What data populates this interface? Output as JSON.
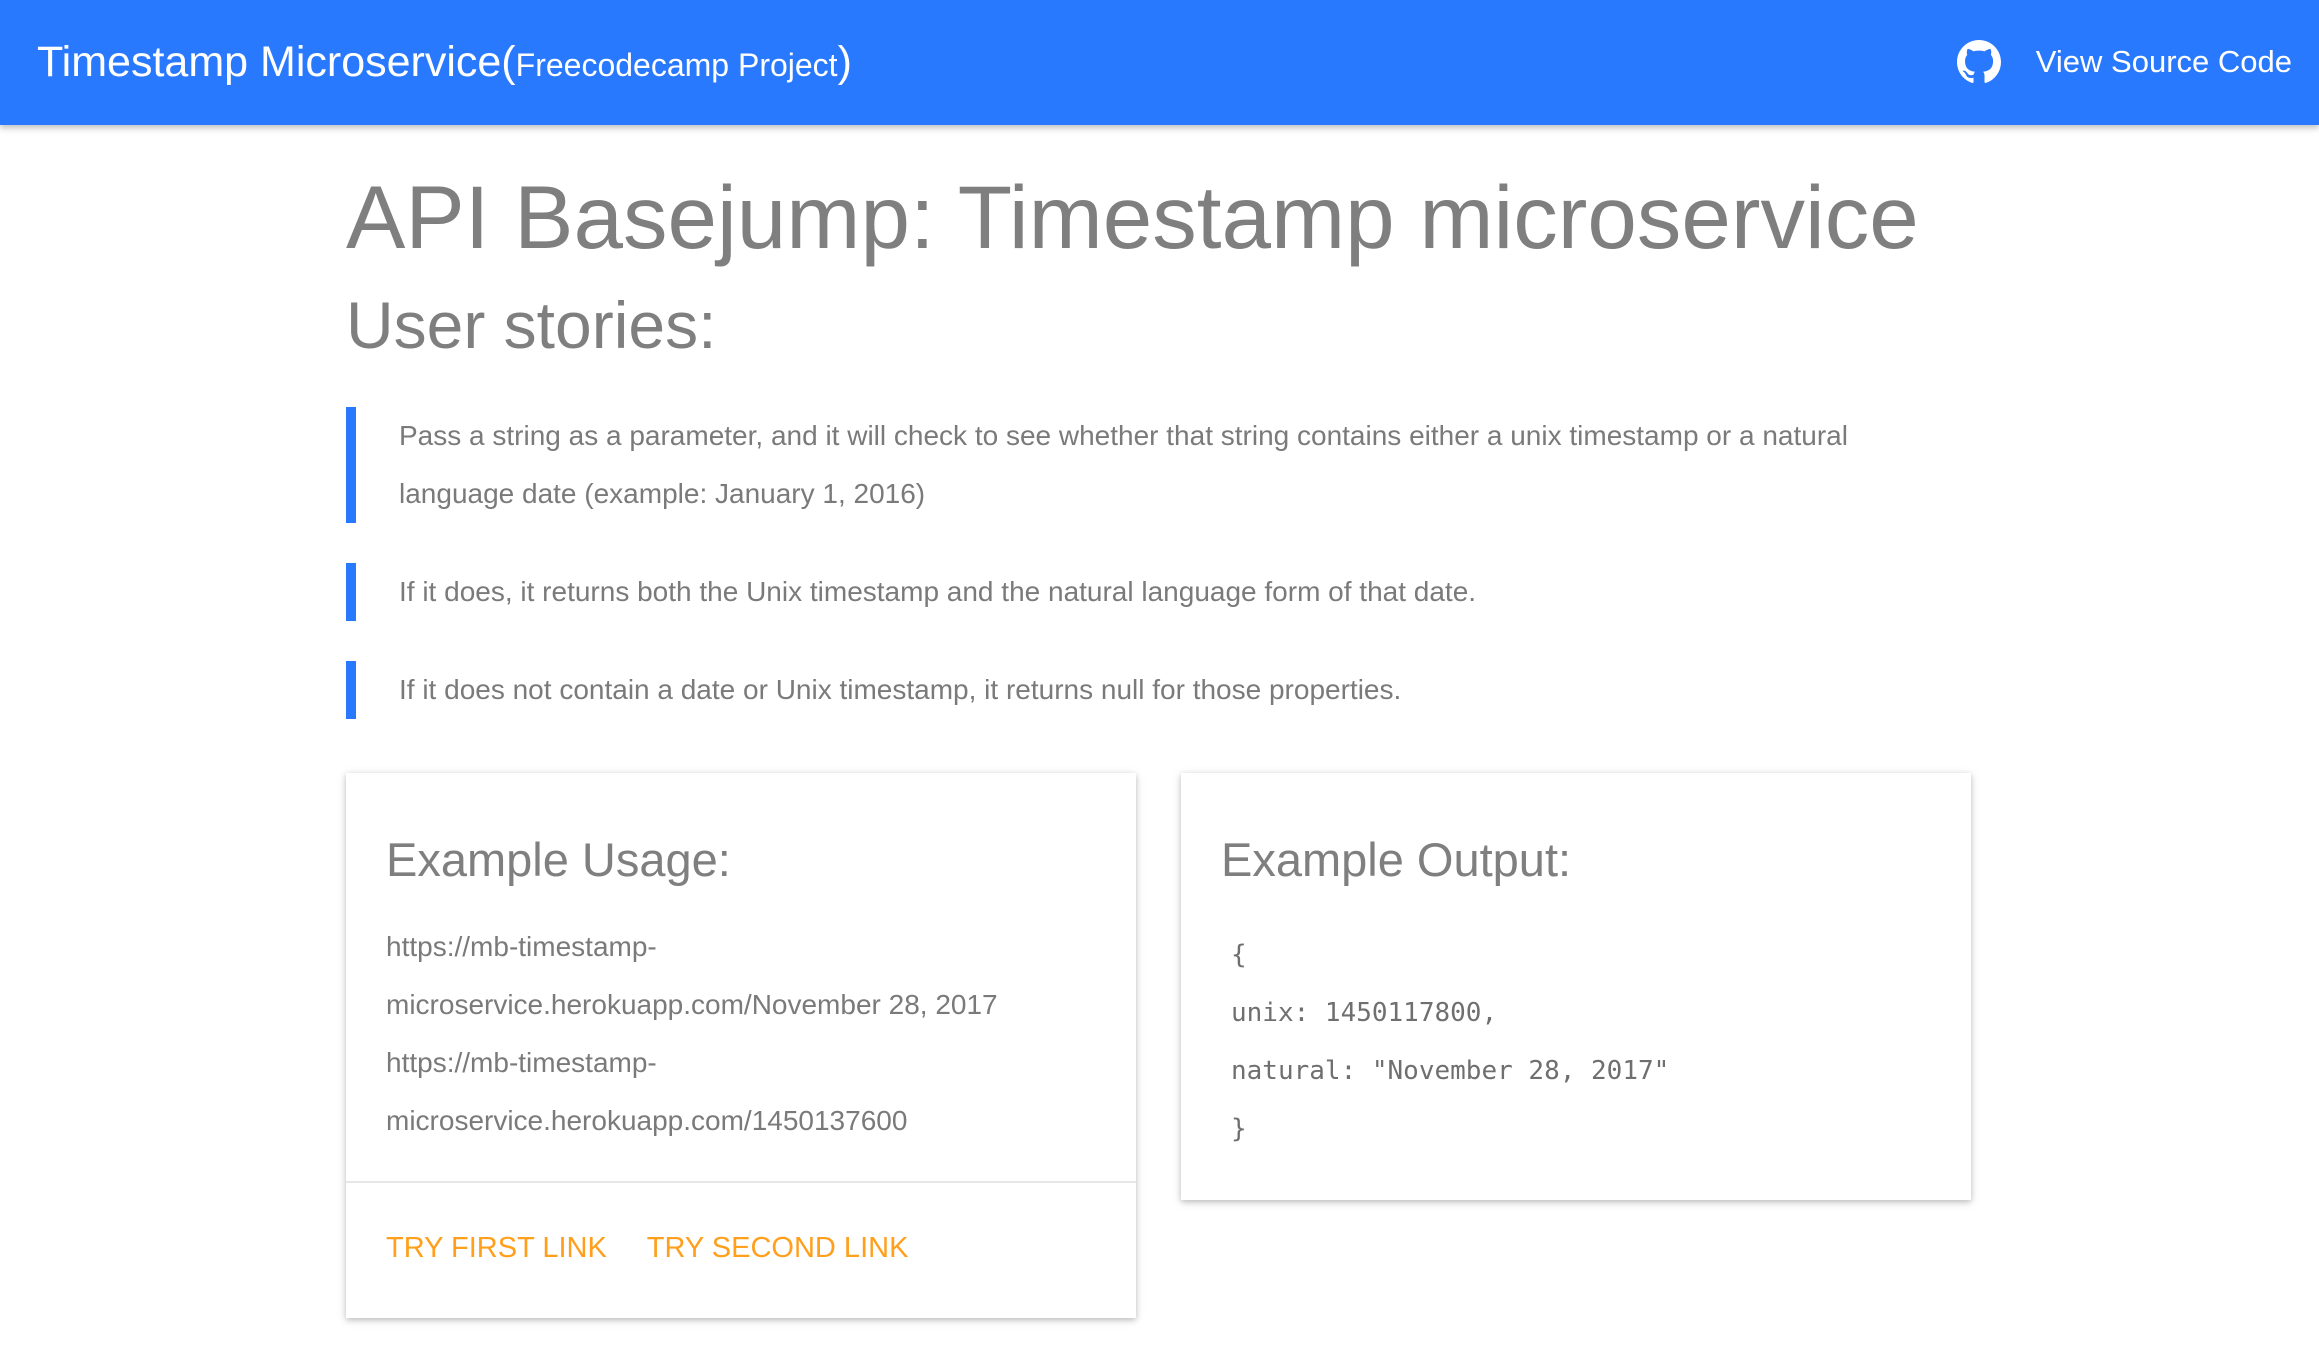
{
  "navbar": {
    "brand_main": "Timestamp Microservice(",
    "brand_sub": "Freecodecamp Project",
    "brand_close": ")",
    "source_link": "View Source Code",
    "github_icon": "github-icon"
  },
  "main": {
    "title": "API Basejump: Timestamp microservice",
    "subtitle": "User stories:",
    "stories": [
      "Pass a string as a parameter, and it will check to see whether that string contains either a unix timestamp or a natural language date (example: January 1, 2016)",
      "If it does, it returns both the Unix timestamp and the natural language form of that date.",
      "If it does not contain a date or Unix timestamp, it returns null for those properties."
    ]
  },
  "usage_card": {
    "title": "Example Usage:",
    "urls": [
      "https://mb-timestamp-microservice.herokuapp.com/November 28, 2017",
      "https://mb-timestamp-microservice.herokuapp.com/1450137600"
    ],
    "actions": [
      "TRY FIRST LINK",
      "TRY SECOND LINK"
    ]
  },
  "output_card": {
    "title": "Example Output:",
    "code_lines": [
      "{",
      "unix: 1450117800,",
      "natural: \"November 28, 2017\"",
      "}"
    ]
  },
  "colors": {
    "primary": "#2979ff",
    "accent": "#ff9f1c",
    "text": "#7f7f7f"
  }
}
